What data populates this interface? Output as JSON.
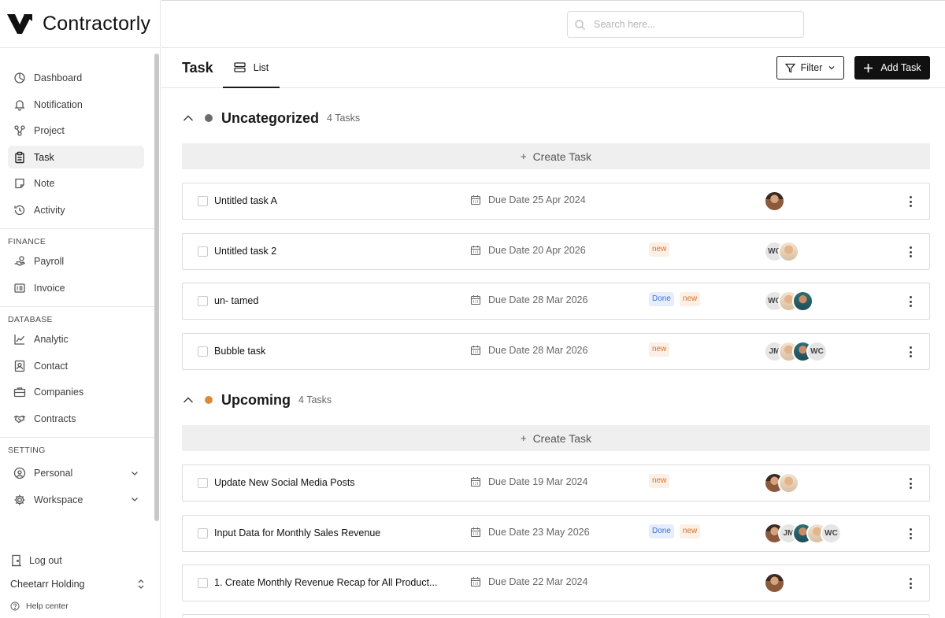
{
  "app": {
    "name": "Contractorly"
  },
  "search": {
    "placeholder": "Search here..."
  },
  "sidebar": {
    "main_items": [
      {
        "label": "Dashboard",
        "icon": "dashboard-icon"
      },
      {
        "label": "Notification",
        "icon": "bell-icon"
      },
      {
        "label": "Project",
        "icon": "project-icon"
      },
      {
        "label": "Task",
        "icon": "clipboard-icon",
        "active": true
      },
      {
        "label": "Note",
        "icon": "note-icon"
      },
      {
        "label": "Activity",
        "icon": "history-icon"
      }
    ],
    "finance": {
      "title": "FINANCE",
      "items": [
        {
          "label": "Payroll",
          "icon": "hand-money-icon"
        },
        {
          "label": "Invoice",
          "icon": "invoice-icon"
        }
      ]
    },
    "database": {
      "title": "DATABASE",
      "items": [
        {
          "label": "Analytic",
          "icon": "chart-line-icon"
        },
        {
          "label": "Contact",
          "icon": "contact-icon"
        },
        {
          "label": "Companies",
          "icon": "briefcase-icon"
        },
        {
          "label": "Contracts",
          "icon": "handshake-icon"
        }
      ]
    },
    "setting": {
      "title": "SETTING",
      "items": [
        {
          "label": "Personal",
          "icon": "user-settings-icon"
        },
        {
          "label": "Workspace",
          "icon": "gear-icon"
        }
      ]
    },
    "logout": "Log out",
    "org": "Cheetarr Holding",
    "help": "Help center"
  },
  "header": {
    "title": "Task",
    "view_tab": "List",
    "filter_label": "Filter",
    "add_label": "Add Task"
  },
  "groups": [
    {
      "name": "Uncategorized",
      "count": "4 Tasks",
      "color": "#6b6b6b",
      "create_label": "Create Task",
      "tasks": [
        {
          "name": "Untitled task A",
          "due": "Due Date 25 Apr 2024",
          "badges": [],
          "avatars": [
            "photo"
          ]
        },
        {
          "name": "Untitled task 2",
          "due": "Due Date 20 Apr 2026",
          "badges": [
            "new"
          ],
          "avatars": [
            "WC",
            "photo"
          ]
        },
        {
          "name": "un- tamed",
          "due": "Due Date 28 Mar 2026",
          "badges": [
            "Done",
            "new"
          ],
          "avatars": [
            "WC",
            "photo",
            "photo"
          ]
        },
        {
          "name": "Bubble task",
          "due": "Due Date 28 Mar 2026",
          "badges": [
            "new"
          ],
          "avatars": [
            "JM",
            "photo",
            "photo",
            "WC"
          ]
        }
      ]
    },
    {
      "name": "Upcoming",
      "count": "4 Tasks",
      "color": "#d98a3a",
      "create_label": "Create Task",
      "tasks": [
        {
          "name": "Update New Social Media Posts",
          "due": "Due Date 19 Mar 2024",
          "badges": [
            "new"
          ],
          "avatars": [
            "photo",
            "photo"
          ]
        },
        {
          "name": "Input Data for Monthly Sales Revenue",
          "due": "Due Date 23 May 2026",
          "badges": [
            "Done",
            "new"
          ],
          "avatars": [
            "photo",
            "JM",
            "photo",
            "photo",
            "WC"
          ]
        },
        {
          "name": "1. Create Monthly Revenue Recap for All Product...",
          "due": "Due Date 22 Mar 2024",
          "badges": [],
          "avatars": [
            "photo"
          ]
        }
      ]
    }
  ]
}
